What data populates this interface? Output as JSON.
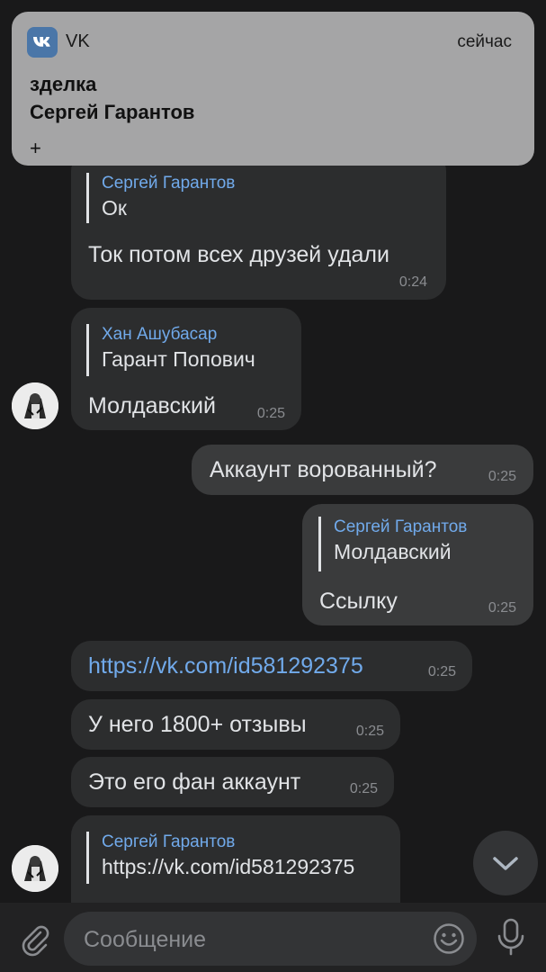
{
  "notification": {
    "app_name": "VK",
    "time": "сейчас",
    "title": "зделка",
    "sender": "Сергей Гарантов",
    "body": "+"
  },
  "messages": [
    {
      "reply_name": "Сергей Гарантов",
      "reply_text": "Ок",
      "text": "Ток потом всех друзей удали",
      "time": "0:24"
    },
    {
      "reply_name": "Хан Ашубасар",
      "reply_text": "Гарант Попович",
      "text": "Молдавский",
      "time": "0:25"
    },
    {
      "text": "Аккаунт ворованный?",
      "time": "0:25"
    },
    {
      "reply_name": "Сергей Гарантов",
      "reply_text": "Молдавский",
      "text": "Ссылку",
      "time": "0:25"
    },
    {
      "text": "https://vk.com/id581292375",
      "time": "0:25"
    },
    {
      "text": "У него 1800+ отзывы",
      "time": "0:25"
    },
    {
      "text": "Это его фан аккаунт",
      "time": "0:25"
    },
    {
      "reply_name": "Сергей Гарантов",
      "reply_text": "https://vk.com/id581292375"
    }
  ],
  "input": {
    "placeholder": "Сообщение"
  },
  "icons": {
    "attach": "paperclip-icon",
    "emoji": "emoji-icon",
    "mic": "microphone-icon",
    "scroll": "chevron-down-icon",
    "app": "vk-logo-icon"
  },
  "colors": {
    "background": "#19191a",
    "incoming_bubble": "#2c2d2e",
    "outgoing_bubble": "#3a3b3c",
    "link": "#71aaeb",
    "text": "#e1e3e6",
    "time": "#8a8c90",
    "notification": "#a5a5a6"
  }
}
